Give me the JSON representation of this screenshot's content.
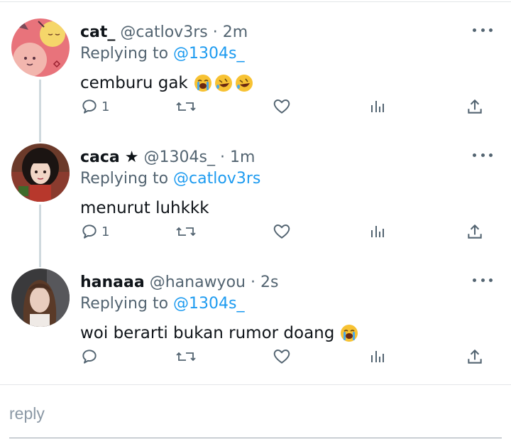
{
  "tweets": [
    {
      "name": "cat_",
      "star": "",
      "handle": "@catlov3rs",
      "time": "2m",
      "replying_prefix": "Replying to ",
      "replying_to": "@1304s_",
      "text": "cemburu gak",
      "emojis": [
        "loudly-crying-face",
        "rolling-on-floor-laughing",
        "rolling-on-floor-laughing"
      ],
      "reply_count": "1"
    },
    {
      "name": "caca",
      "star": "★",
      "handle": "@1304s_",
      "time": "1m",
      "replying_prefix": "Replying to ",
      "replying_to": "@catlov3rs",
      "text": "menurut luhkkk",
      "emojis": [],
      "reply_count": "1"
    },
    {
      "name": "hanaaa",
      "star": "",
      "handle": "@hanawyou",
      "time": "2s",
      "replying_prefix": "Replying to ",
      "replying_to": "@1304s_",
      "text": "woi berarti bukan rumor doang",
      "emojis": [
        "loudly-crying-face"
      ],
      "reply_count": ""
    }
  ],
  "dot_separator": "·",
  "action_icons": [
    "reply-icon",
    "retweet-icon",
    "like-icon",
    "analytics-icon",
    "share-icon"
  ],
  "reply_box": {
    "placeholder": "reply"
  },
  "colors": {
    "link": "#1d9bf0",
    "secondary_text": "#536471",
    "thread_line": "#cfd9de"
  }
}
